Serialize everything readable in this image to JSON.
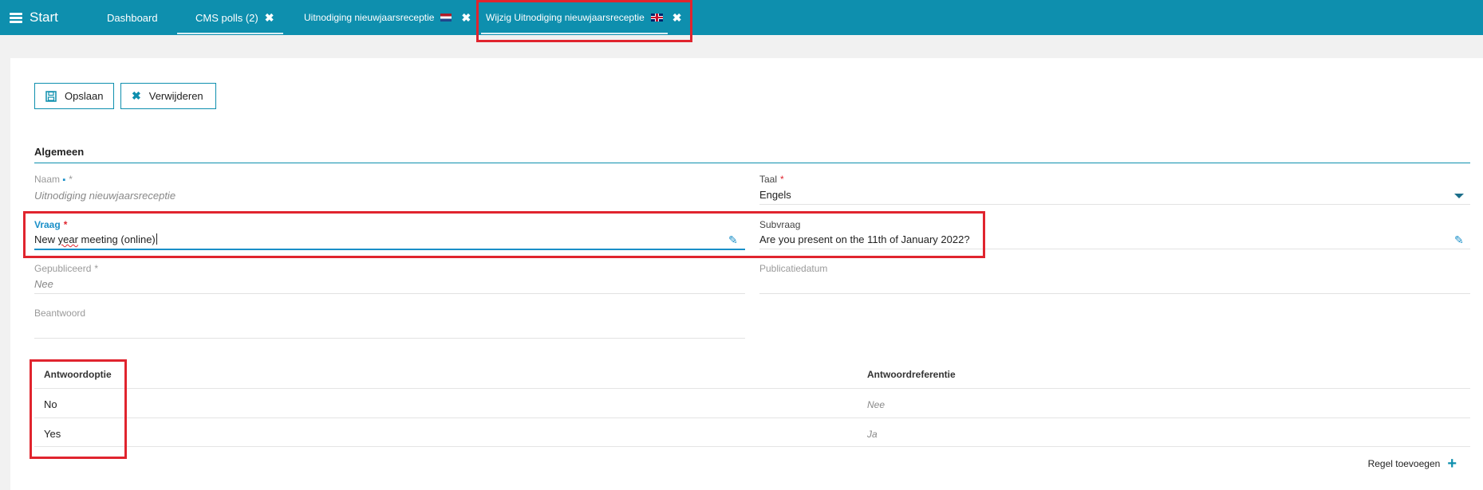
{
  "nav": {
    "start_label": "Start",
    "tabs": [
      {
        "label": "Dashboard"
      },
      {
        "label": "CMS polls (2)"
      },
      {
        "label": "Uitnodiging nieuwjaarsreceptie"
      },
      {
        "label": "Wijzig Uitnodiging nieuwjaarsreceptie"
      }
    ]
  },
  "toolbar": {
    "save_label": "Opslaan",
    "delete_label": "Verwijderen"
  },
  "section": {
    "title": "Algemeen"
  },
  "fields": {
    "naam": {
      "label": "Naam",
      "value": "Uitnodiging nieuwjaarsreceptie"
    },
    "taal": {
      "label": "Taal",
      "value": "Engels"
    },
    "vraag": {
      "label": "Vraag",
      "value_part1": "New ",
      "value_part2": "year",
      "value_part3": " meeting (online)"
    },
    "subvraag": {
      "label": "Subvraag",
      "value": "Are you present on the 11th of January 2022?"
    },
    "gepubliceerd": {
      "label": "Gepubliceerd",
      "value": "Nee"
    },
    "publicatiedatum": {
      "label": "Publicatiedatum",
      "value": ""
    },
    "beantwoord": {
      "label": "Beantwoord",
      "value": ""
    }
  },
  "answers": {
    "headers": {
      "option": "Antwoordoptie",
      "reference": "Antwoordreferentie"
    },
    "rows": [
      {
        "option": "No",
        "reference": "Nee"
      },
      {
        "option": "Yes",
        "reference": "Ja"
      }
    ],
    "add_label": "Regel toevoegen"
  },
  "colors": {
    "primary": "#0e8fae",
    "highlight": "#e0242e",
    "active": "#1a8fc8"
  }
}
